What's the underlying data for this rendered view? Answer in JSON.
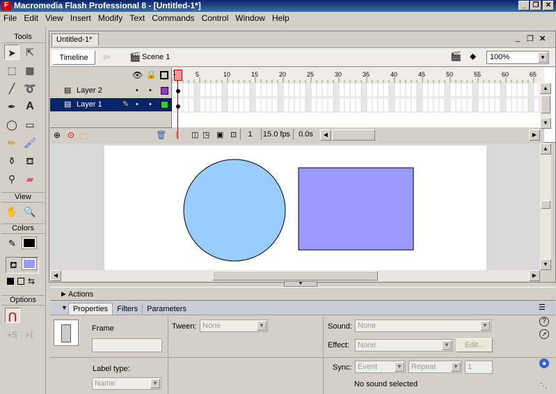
{
  "window": {
    "title": "Macromedia Flash Professional 8 - [Untitled-1*]",
    "logo_letter": "F"
  },
  "menu": [
    "File",
    "Edit",
    "View",
    "Insert",
    "Modify",
    "Text",
    "Commands",
    "Control",
    "Window",
    "Help"
  ],
  "tools": {
    "header": "Tools",
    "view_header": "View",
    "colors_header": "Colors",
    "options_header": "Options"
  },
  "document": {
    "tab": "Untitled-1*",
    "timeline_button": "Timeline",
    "scene": "Scene 1",
    "zoom": "100%"
  },
  "timeline": {
    "frame_numbers": [
      "1",
      "5",
      "10",
      "15",
      "20",
      "25",
      "30",
      "35",
      "40",
      "45",
      "50",
      "55",
      "60",
      "65"
    ],
    "layers": [
      {
        "name": "Layer 2",
        "color": "#9933cc"
      },
      {
        "name": "Layer 1",
        "color": "#33cc33"
      }
    ],
    "current_frame": "1",
    "fps": "15.0 fps",
    "elapsed": "0.0s"
  },
  "stage": {
    "circle_fill": "#99ccff",
    "rect_fill": "#9999ff"
  },
  "panels": {
    "actions": "Actions",
    "tabs": [
      "Properties",
      "Filters",
      "Parameters"
    ],
    "frame_label": "Frame",
    "tween_label": "Tween:",
    "tween_value": "None",
    "sound_label": "Sound:",
    "sound_value": "None",
    "effect_label": "Effect:",
    "effect_value": "None",
    "edit_button": "Edit...",
    "label_type_label": "Label type:",
    "label_type_value": "Name",
    "sync_label": "Sync:",
    "sync_value": "Event",
    "repeat_value": "Repeat",
    "repeat_count": "1",
    "no_sound": "No sound selected"
  }
}
